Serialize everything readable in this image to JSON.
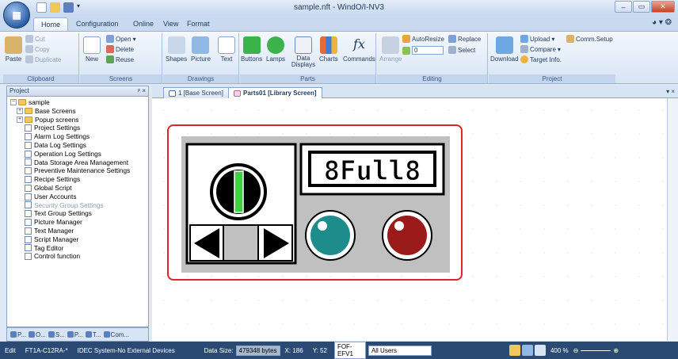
{
  "window": {
    "title": "sample.nft - WindO/I-NV3"
  },
  "tabs": [
    "Home",
    "Configuration",
    "Online",
    "View",
    "Format"
  ],
  "ribbon": {
    "clipboard": {
      "label": "Clipboard",
      "paste": "Paste",
      "cut": "Cut",
      "copy": "Copy",
      "duplicate": "Duplicate"
    },
    "screens": {
      "label": "Screens",
      "new": "New",
      "open": "Open",
      "delete": "Delete",
      "reuse": "Reuse"
    },
    "drawings": {
      "label": "Drawings",
      "shapes": "Shapes",
      "picture": "Picture",
      "text": "Text"
    },
    "parts": {
      "label": "Parts",
      "buttons": "Buttons",
      "lamps": "Lamps",
      "data_displays": "Data Displays",
      "charts": "Charts",
      "commands": "Commands"
    },
    "editing": {
      "label": "Editing",
      "arrange": "Arrange",
      "autoresize": "AutoResize",
      "value": "0",
      "replace": "Replace",
      "select": "Select"
    },
    "project": {
      "label": "Project",
      "download": "Download",
      "upload": "Upload",
      "compare": "Compare",
      "target_info": "Target Info.",
      "comm_setup": "Comm.Setup"
    }
  },
  "panel": {
    "title": "Project",
    "pin": "ᵖ ×",
    "tree": [
      {
        "label": "sample",
        "kind": "root"
      },
      {
        "label": "Base Screens",
        "kind": "folder"
      },
      {
        "label": "Popup screens",
        "kind": "folder"
      },
      {
        "label": "Project Settings",
        "kind": "doc"
      },
      {
        "label": "Alarm Log Settings",
        "kind": "doc"
      },
      {
        "label": "Data Log Settings",
        "kind": "doc"
      },
      {
        "label": "Operation Log Settings",
        "kind": "doc"
      },
      {
        "label": "Data Storage Area Management",
        "kind": "doc"
      },
      {
        "label": "Preventive Maintenance Settings",
        "kind": "doc"
      },
      {
        "label": "Recipe Settings",
        "kind": "doc"
      },
      {
        "label": "Global Script",
        "kind": "doc"
      },
      {
        "label": "User Accounts",
        "kind": "doc"
      },
      {
        "label": "Security Group Settings",
        "kind": "doc",
        "disabled": true
      },
      {
        "label": "Text Group Settings",
        "kind": "doc"
      },
      {
        "label": "Picture Manager",
        "kind": "doc"
      },
      {
        "label": "Text Manager",
        "kind": "doc"
      },
      {
        "label": "Script Manager",
        "kind": "doc"
      },
      {
        "label": "Tag Editor",
        "kind": "doc"
      },
      {
        "label": "Control function",
        "kind": "doc"
      }
    ],
    "bottom_tabs": [
      "P...",
      "O...",
      "S...",
      "P...",
      "T...",
      "Com..."
    ]
  },
  "doctabs": [
    {
      "label": "1 [Base Screen]",
      "active": false
    },
    {
      "label": "Parts01 [Library Screen]",
      "active": true
    }
  ],
  "part": {
    "display_text": "8Full8"
  },
  "status": {
    "mode": "Edit",
    "model": "FT1A-C12RA-*",
    "devices": "IDEC System-No External Devices",
    "data_size_label": "Data Size:",
    "data_size": "479348 bytes",
    "x": "X: 186",
    "y": "Y: 52",
    "font": "FOF-EFV1",
    "users": "All Users",
    "zoom": "400 %"
  }
}
